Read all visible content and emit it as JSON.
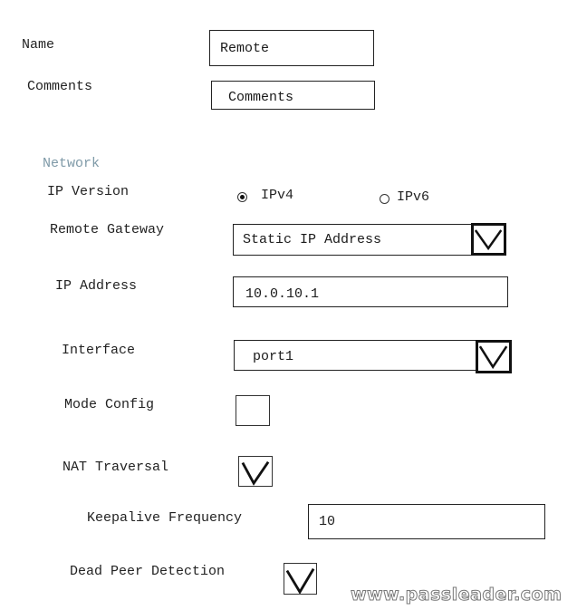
{
  "general": {
    "name_label": "Name",
    "name_value": "Remote",
    "comments_label": "Comments",
    "comments_placeholder": "Comments"
  },
  "network": {
    "section_title": "Network",
    "ip_version": {
      "label": "IP Version",
      "options": [
        {
          "label": "IPv4",
          "selected": true
        },
        {
          "label": "IPv6",
          "selected": false
        }
      ]
    },
    "remote_gateway": {
      "label": "Remote Gateway",
      "value": "Static IP Address"
    },
    "ip_address": {
      "label": "IP Address",
      "value": "10.0.10.1"
    },
    "interface": {
      "label": "Interface",
      "value": "port1"
    },
    "mode_config": {
      "label": "Mode Config",
      "checked": false
    },
    "nat_traversal": {
      "label": "NAT Traversal",
      "checked": true
    },
    "keepalive_frequency": {
      "label": "Keepalive Frequency",
      "value": "10"
    },
    "dead_peer_detection": {
      "label": "Dead Peer Detection",
      "checked": true
    }
  },
  "watermark": "www.passleader.com"
}
